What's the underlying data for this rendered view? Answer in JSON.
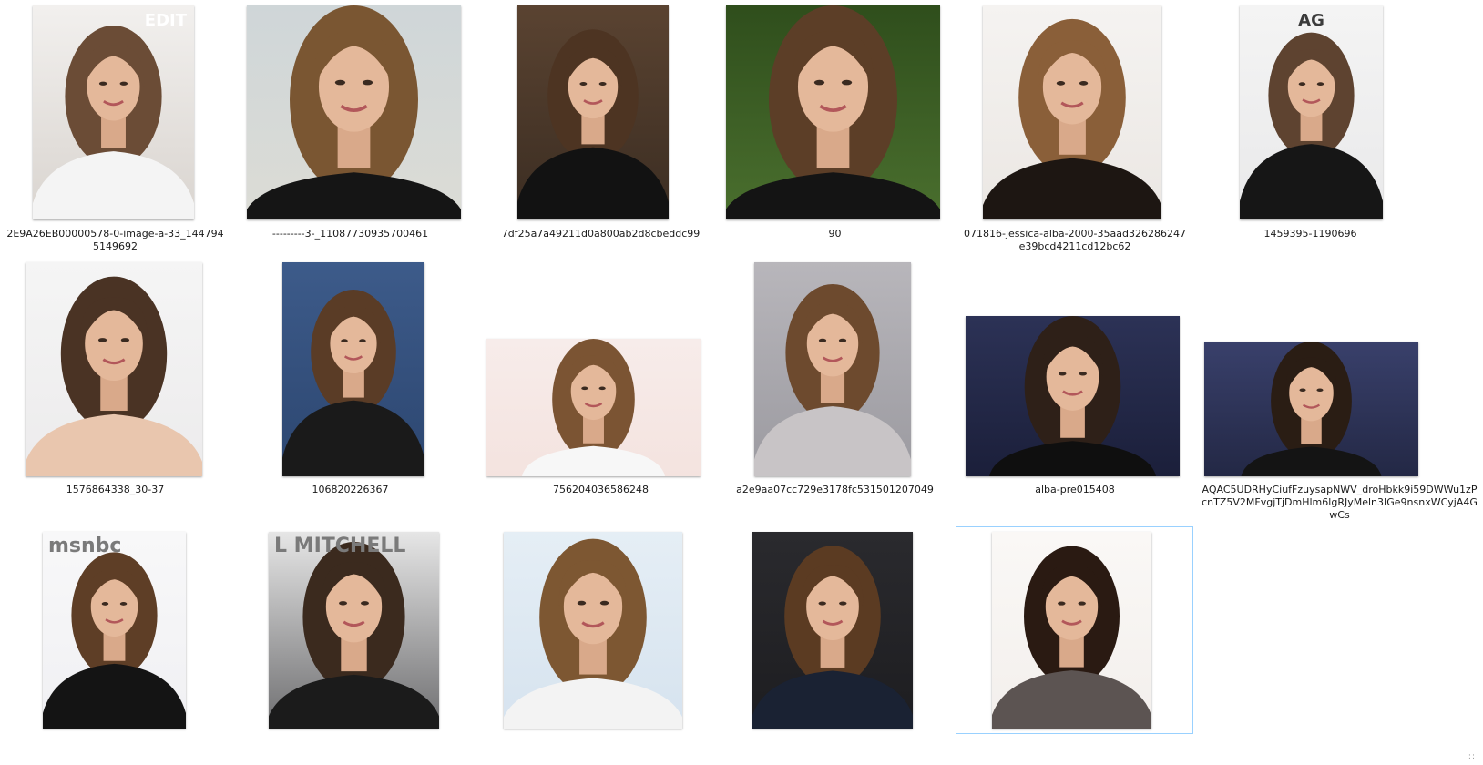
{
  "files": [
    {
      "name": "2E9A26EB00000578-0-image-a-33_1447945149692",
      "icon": "photo-thumbnail",
      "bg": "#d9d4cf",
      "top": "#f2f0ee",
      "fg": "#6b4c36",
      "shirt": "#f4f4f4",
      "text_mark": "EDIT"
    },
    {
      "name": "---------3-_11087730935700461",
      "icon": "photo-thumbnail",
      "bg": "#dcdcd6",
      "top": "#cfd6d8",
      "fg": "#7a5632",
      "shirt": "#151515"
    },
    {
      "name": "7df25a7a49211d0a800ab2d8cbeddc99",
      "icon": "photo-thumbnail",
      "bg": "#3b2d22",
      "top": "#5a4331",
      "fg": "#4d3422",
      "shirt": "#121212"
    },
    {
      "name": "90",
      "icon": "photo-thumbnail",
      "bg": "#4a6f2e",
      "top": "#2f4e1c",
      "fg": "#5c3e27",
      "shirt": "#141414"
    },
    {
      "name": "071816-jessica-alba-2000-35aad326286247e39bcd4211cd12bc62",
      "icon": "photo-thumbnail",
      "bg": "#ebe7e3",
      "top": "#f5f3f1",
      "fg": "#8a5f39",
      "shirt": "#1d1612"
    },
    {
      "name": "1459395-1190696",
      "icon": "photo-thumbnail",
      "bg": "#e9e9ea",
      "top": "#f4f4f4",
      "fg": "#5e4330",
      "shirt": "#161616",
      "text_mark": "AG"
    },
    {
      "name": "1576864338_30-37",
      "icon": "photo-thumbnail",
      "bg": "#ecebec",
      "top": "#f5f5f5",
      "fg": "#4a3324",
      "shirt": "#e9c6ae"
    },
    {
      "name": "106820226367",
      "icon": "photo-thumbnail",
      "bg": "#2c4670",
      "top": "#3d5b8a",
      "fg": "#5a3c26",
      "shirt": "#1a1a1a"
    },
    {
      "name": "756204036586248",
      "icon": "photo-thumbnail",
      "bg": "#f4e3df",
      "top": "#f7ecea",
      "fg": "#7b5433",
      "shirt": "#f7f7f7"
    },
    {
      "name": "a2e9aa07cc729e3178fc531501207049",
      "icon": "photo-thumbnail",
      "bg": "#9b9aa0",
      "top": "#b8b6bb",
      "fg": "#6d4a2e",
      "shirt": "#c8c4c6"
    },
    {
      "name": "alba-pre015408",
      "icon": "photo-thumbnail",
      "bg": "#1b1f3a",
      "top": "#2c3256",
      "fg": "#2e2018",
      "shirt": "#0f0f0f"
    },
    {
      "name": "AQAC5UDRHyCiufFzuysapNWV_droHbkk9i59DWWu1zPcnTZ5V2MFvgjTjDmHlm6lgRJyMeln3IGe9nsnxWCyjA4GwCs",
      "icon": "photo-thumbnail",
      "bg": "#232845",
      "top": "#39406b",
      "fg": "#2a1d14",
      "shirt": "#141414"
    },
    {
      "name": "",
      "icon": "photo-thumbnail",
      "bg": "#f0f0f3",
      "top": "#f8f8f9",
      "fg": "#5e3e26",
      "shirt": "#141414",
      "text_mark": "msnbc"
    },
    {
      "name": "",
      "icon": "photo-thumbnail",
      "bg": "#6e6e70",
      "top": "#e6e6e6",
      "fg": "#3b2a1e",
      "shirt": "#1b1b1b",
      "text_mark": "L MITCHELL"
    },
    {
      "name": "",
      "icon": "photo-thumbnail",
      "bg": "#d6e3ef",
      "top": "#e5eef5",
      "fg": "#7d5732",
      "shirt": "#f3f3f3"
    },
    {
      "name": "",
      "icon": "photo-thumbnail",
      "bg": "#1d1d20",
      "top": "#2a2a2e",
      "fg": "#5b3b22",
      "shirt": "#1a2233"
    },
    {
      "name": "",
      "icon": "photo-thumbnail",
      "bg": "#f3efec",
      "top": "#faf8f6",
      "fg": "#2a1a12",
      "shirt": "#5c5452"
    }
  ],
  "status": {
    "grip": "::"
  }
}
